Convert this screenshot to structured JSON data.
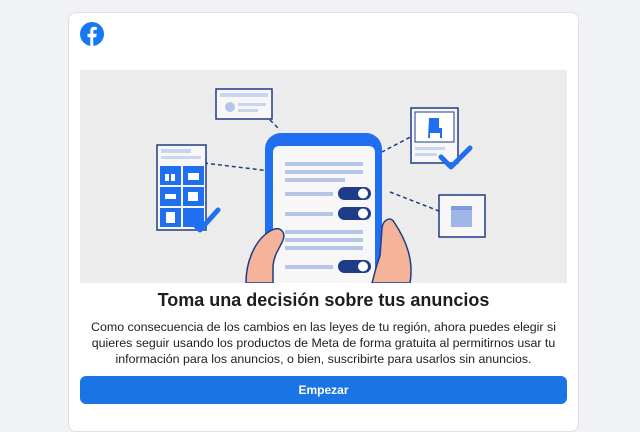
{
  "brand": {
    "logo_icon": "facebook-logo-icon",
    "color": "#1877f2"
  },
  "dialog": {
    "headline": "Toma una decisión sobre tus anuncios",
    "description": "Como consecuencia de los cambios en las leyes de tu región, ahora puedes elegir si quieres seguir usando los productos de Meta de forma gratuita al permitirnos usar tu información para los anuncios, o bien, suscribirte para usarlos sin anuncios.",
    "primary_button": "Empezar"
  },
  "colors": {
    "button": "#1b74e4",
    "hero_background": "#ececec",
    "illustration_blue": "#1f6ff0"
  }
}
